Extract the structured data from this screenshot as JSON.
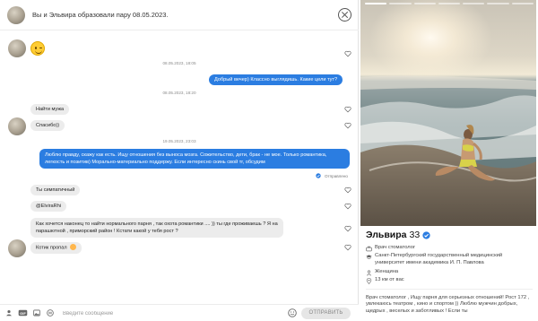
{
  "header": {
    "match_text": "Вы и Эльвира образовали пару 08.05.2023."
  },
  "timestamps": {
    "t1": "08.05.2023, 18:05",
    "t2": "08.05.2023, 18:20",
    "t3": "19.05.2023, 23:03"
  },
  "messages": {
    "m_out1": "Добрый вечер) Классно выглядишь. Какие цели тут?",
    "m_in1": "Найти мужа",
    "m_in2": "Спасибо))",
    "m_out2": "Люблю правду, скажу как есть. Ищу отношения без выноса мозга. Сожительство, дети, брак - не мое. Только романтика, легкость и позитив) Морально-материально поддержу. Если интересно скинь свой тг, обсудим",
    "sent_status": "Отправлено",
    "m_in3": "Ты симпатичный",
    "m_in4": "@ElviraRhi",
    "m_in5_line1": "Как хочется наконец то найти нормального парня , так охота романтики .... )) ты где проживаешь ? Я на",
    "m_in5_line2": "парашютной , приморский район ! Кстати какой у тебя рост ?",
    "m_in6": "Котик пропал"
  },
  "composer": {
    "placeholder": "Введите сообщение",
    "send_label": "ОТПРАВИТЬ"
  },
  "profile": {
    "name": "Эльвира",
    "age": "33",
    "job": "Врач стоматолог",
    "education": "Санкт-Петербургский государственный медицинский университет имени академика И. П. Павлова",
    "gender": "Женщина",
    "distance": "13 км от вас",
    "about": "Врач стоматолог , Ищу парня для серьезных отношений! Рост 172 , увлекаюсь театром , кино и спортом )) Люблю мужчин добрых, щедрых , веселых и заботливых ! Если ты"
  },
  "colors": {
    "accent": "#2b7de1",
    "incoming_bubble": "#ececec",
    "verified_badge": "#2b7de1"
  },
  "icons": {
    "close": "close-circle-icon",
    "heart": "heart-outline-icon",
    "verified": "verified-check-icon",
    "job": "briefcase-icon",
    "education": "graduation-cap-icon",
    "gender": "person-icon",
    "location": "location-pin-icon",
    "sent": "check-circle-icon",
    "composer_icons": [
      "person-add-icon",
      "gif-icon",
      "image-icon",
      "sticker-icon",
      "emoji-icon"
    ]
  }
}
